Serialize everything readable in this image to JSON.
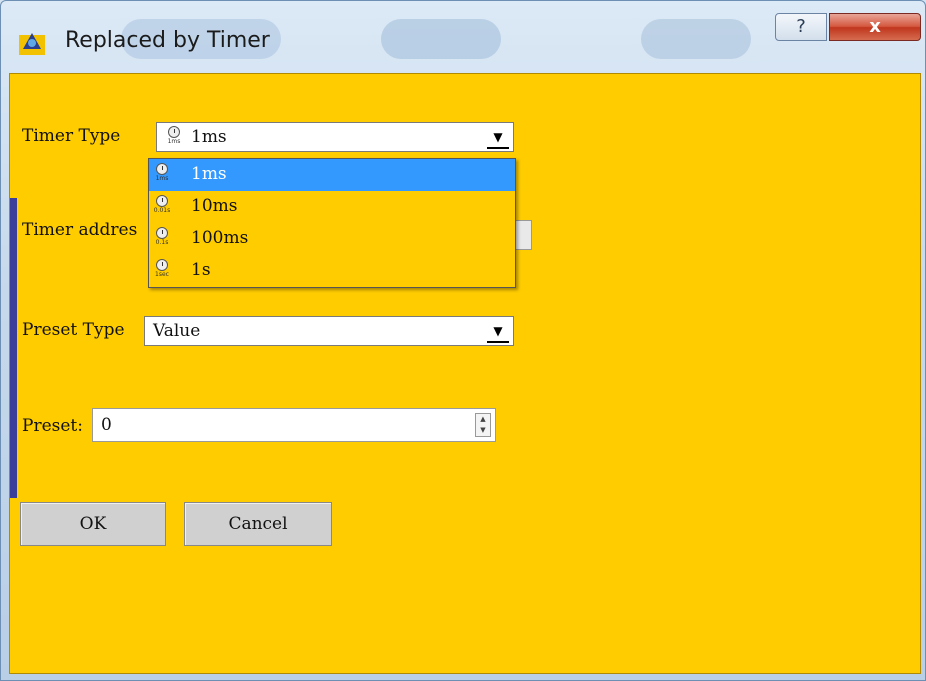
{
  "window": {
    "title": "Replaced by Timer",
    "help_label": "?",
    "close_label": "x"
  },
  "form": {
    "timer_type_label": "Timer Type",
    "timer_type_value": "1ms",
    "timer_type_icon_unit": "1ms",
    "timer_address_label": "Timer addres",
    "preset_type_label": "Preset Type",
    "preset_type_value": "Value",
    "preset_label": "Preset:",
    "preset_value": "0"
  },
  "dropdown": {
    "items": [
      {
        "label": "1ms",
        "unit": "1ms",
        "selected": true
      },
      {
        "label": "10ms",
        "unit": "0.01s",
        "selected": false
      },
      {
        "label": "100ms",
        "unit": "0.1s",
        "selected": false
      },
      {
        "label": "1s",
        "unit": "1sec",
        "selected": false
      }
    ]
  },
  "buttons": {
    "ok": "OK",
    "cancel": "Cancel"
  },
  "colors": {
    "client_bg": "#ffcc00",
    "selection": "#3399ff",
    "close_red": "#c0361d"
  }
}
